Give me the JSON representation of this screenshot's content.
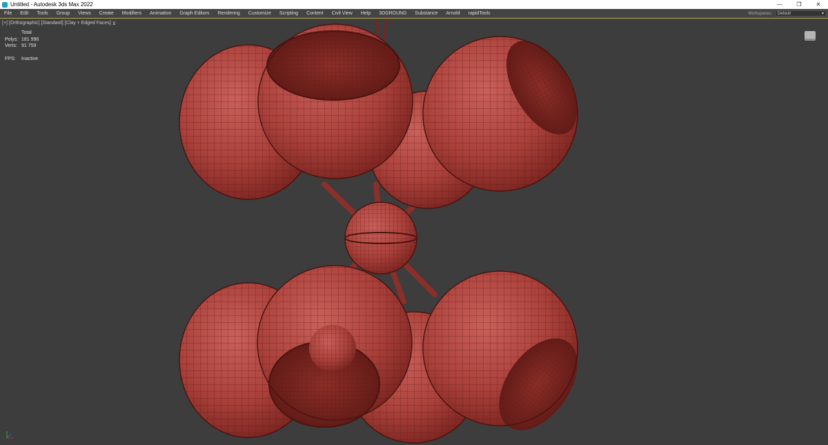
{
  "window": {
    "title": "Untitled - Autodesk 3ds Max 2022",
    "controls": [
      "minimize-icon",
      "restore-icon",
      "close-icon"
    ]
  },
  "menubar": {
    "items": [
      "File",
      "Edit",
      "Tools",
      "Group",
      "Views",
      "Create",
      "Modifiers",
      "Animation",
      "Graph Editors",
      "Rendering",
      "Customize",
      "Scripting",
      "Content",
      "Civil View",
      "Help",
      "3DGROUND",
      "Substance",
      "Arnold",
      "rapidTools"
    ],
    "workspaces_label": "Workspaces:",
    "workspaces_value": "Default"
  },
  "viewport": {
    "label_parts": [
      "[+]",
      "[Orthographic]",
      "[Standard]",
      "[Clay + Edged Faces]"
    ],
    "filter_icon": "funnel-icon",
    "stats": {
      "header": "Total",
      "polys_label": "Polys:",
      "polys_value": "181 996",
      "verts_label": "Verts:",
      "verts_value": "91 759",
      "fps_label": "FPS:",
      "fps_value": "Inactive"
    },
    "colors": {
      "background": "#3d3d3d",
      "model": "#b0403a",
      "wire": "#5a1612",
      "active_border": "#b8a850"
    }
  }
}
